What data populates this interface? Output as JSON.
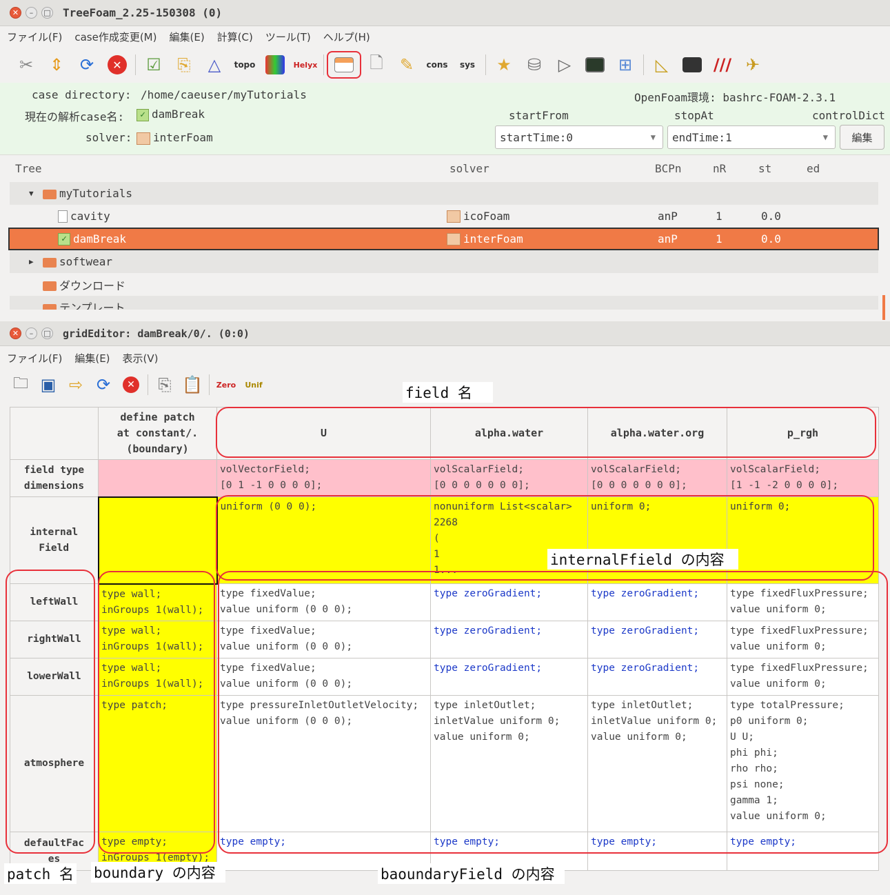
{
  "main_window": {
    "title": "TreeFoam_2.25-150308 (0)",
    "menus": [
      "ファイル(F)",
      "case作成変更(M)",
      "編集(E)",
      "計算(C)",
      "ツール(T)",
      "ヘルプ(H)"
    ],
    "toolbar_icons": [
      "tools-icon",
      "updown-icon",
      "refresh-icon",
      "stop-icon",
      "checklist-icon",
      "copy-icon",
      "mesh-icon",
      "topo-icon",
      "mreg-icon",
      "helyx-icon",
      "grid-editor-icon",
      "doc-icon",
      "edit-icon",
      "cons-icon",
      "sys-icon",
      "folder-star-icon",
      "clear-icon",
      "run-icon",
      "monitor-icon",
      "layout-icon",
      "triangle-icon",
      "terminal-icon",
      "paraview-icon",
      "plane-icon"
    ],
    "case_directory_label": "case directory:",
    "case_directory_value": "/home/caeuser/myTutorials",
    "openfoam_env": "OpenFoam環境: bashrc-FOAM-2.3.1",
    "current_case_label": "現在の解析case名:",
    "current_case_value": "damBreak",
    "solver_label": "solver:",
    "solver_value": "interFoam",
    "start_from_label": "startFrom",
    "start_from_value": "startTime:0",
    "stop_at_label": "stopAt",
    "stop_at_value": "endTime:1",
    "control_dict_label": "controlDict",
    "edit_button": "編集",
    "tree_columns": [
      "Tree",
      "solver",
      "BCPn",
      "nR",
      "st",
      "ed"
    ],
    "tree_rows": [
      {
        "name": "myTutorials",
        "solver": "",
        "bcpn": "",
        "nr": "",
        "st": "",
        "kind": "folder-open"
      },
      {
        "name": "cavity",
        "solver": "icoFoam",
        "bcpn": "anP",
        "nr": "1",
        "st": "0.0",
        "kind": "file"
      },
      {
        "name": "damBreak",
        "solver": "interFoam",
        "bcpn": "anP",
        "nr": "1",
        "st": "0.0",
        "kind": "check"
      },
      {
        "name": "softwear",
        "solver": "",
        "bcpn": "",
        "nr": "",
        "st": "",
        "kind": "folder-closed"
      },
      {
        "name": "ダウンロード",
        "solver": "",
        "bcpn": "",
        "nr": "",
        "st": "",
        "kind": "folder"
      },
      {
        "name": "テンプレート",
        "solver": "",
        "bcpn": "",
        "nr": "",
        "st": "",
        "kind": "folder"
      }
    ]
  },
  "grid_window": {
    "title": "gridEditor: damBreak/0/. (0:0)",
    "menus": [
      "ファイル(F)",
      "編集(E)",
      "表示(V)"
    ],
    "toolbar_icons": [
      "open-folder-icon",
      "save-icon",
      "export-icon",
      "refresh-icon",
      "stop-icon",
      "copy-icon",
      "paste-icon",
      "zero-icon",
      "unif-icon"
    ],
    "header_define_patch": "define patch\nat constant/.\n(boundary)",
    "fields": [
      "U",
      "alpha.water",
      "alpha.water.org",
      "p_rgh"
    ],
    "row_field_type": "field type\ndimensions",
    "row_internal": "internal\nField",
    "field_types": [
      "volVectorField;\n[0 1 -1 0 0 0 0];",
      "volScalarField;\n[0 0 0 0 0 0 0];",
      "volScalarField;\n[0 0 0 0 0 0 0];",
      "volScalarField;\n[1 -1 -2 0 0 0 0];"
    ],
    "internal_values": [
      "uniform (0 0 0);",
      "nonuniform List<scalar>\n2268\n(\n1\n1...",
      "uniform 0;",
      "uniform 0;"
    ],
    "patches": [
      {
        "name": "leftWall",
        "boundary": "type wall;\ninGroups 1(wall);",
        "values": [
          "type fixedValue;\nvalue uniform (0 0 0);",
          "type zeroGradient;",
          "type zeroGradient;",
          "type fixedFluxPressure;\nvalue uniform 0;"
        ]
      },
      {
        "name": "rightWall",
        "boundary": "type wall;\ninGroups 1(wall);",
        "values": [
          "type fixedValue;\nvalue uniform (0 0 0);",
          "type zeroGradient;",
          "type zeroGradient;",
          "type fixedFluxPressure;\nvalue uniform 0;"
        ]
      },
      {
        "name": "lowerWall",
        "boundary": "type wall;\ninGroups 1(wall);",
        "values": [
          "type fixedValue;\nvalue uniform (0 0 0);",
          "type zeroGradient;",
          "type zeroGradient;",
          "type fixedFluxPressure;\nvalue uniform 0;"
        ]
      },
      {
        "name": "atmosphere",
        "boundary": "type patch;",
        "values": [
          "type pressureInletOutletVelocity;\nvalue uniform (0 0 0);",
          "type inletOutlet;\ninletValue uniform 0;\nvalue uniform 0;",
          "type inletOutlet;\ninletValue uniform 0;\nvalue uniform 0;",
          "type totalPressure;\np0 uniform 0;\nU U;\nphi phi;\nrho rho;\npsi none;\ngamma 1;\nvalue uniform 0;"
        ]
      },
      {
        "name": "defaultFac\nes",
        "boundary": "type empty;\ninGroups 1(empty);",
        "values": [
          "type empty;",
          "type empty;",
          "type empty;",
          "type empty;"
        ]
      }
    ]
  },
  "annotations": {
    "field_name": "field 名",
    "internal_field": "internalFfield の内容",
    "patch_name": "patch 名",
    "boundary": "boundary の内容",
    "boundary_field": "baoundaryField の内容"
  },
  "colors": {
    "selected_row": "#f07a46",
    "pink": "#ffc0cb",
    "yellow": "#ffff00",
    "annotation_red": "#e8303a",
    "info_bg": "#eaf7e8"
  }
}
